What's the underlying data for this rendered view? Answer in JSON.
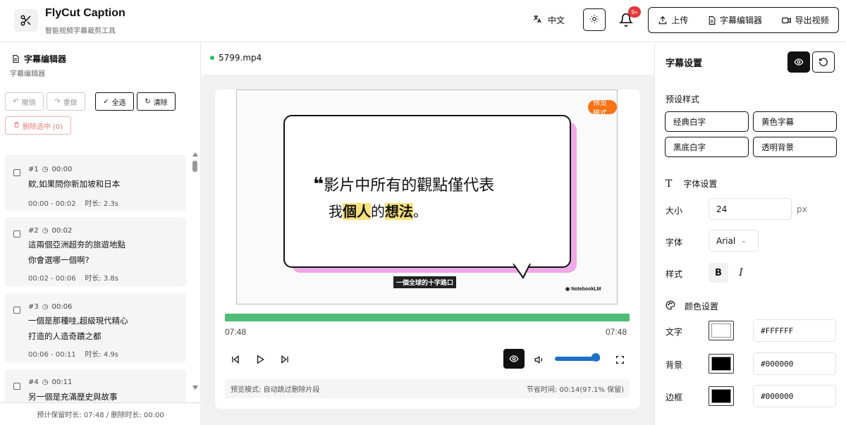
{
  "header": {
    "title": "FlyCut Caption",
    "subtitle": "智能视频字幕裁剪工具",
    "language": "中文",
    "notification_count": "9+",
    "upload_label": "上传",
    "editor_label": "字幕编辑器",
    "export_label": "导出视频"
  },
  "left_panel": {
    "title": "字幕编辑器",
    "subtitle": "字幕编辑器",
    "undo_label": "撤销",
    "redo_label": "重做",
    "select_all_label": "全选",
    "clear_label": "清除",
    "delete_selected_label": "删除选中 (0)",
    "items": [
      {
        "index": "#1",
        "time": "00:00",
        "lines": [
          "欸,如果問你新加坡和日本"
        ],
        "range": "00:00 - 00:02",
        "duration": "时长: 2.3s"
      },
      {
        "index": "#2",
        "time": "00:02",
        "lines": [
          "這兩個亞洲超夯的旅遊地點",
          "你會選哪一個啊?"
        ],
        "range": "00:02 - 00:06",
        "duration": "时长: 3.8s"
      },
      {
        "index": "#3",
        "time": "00:06",
        "lines": [
          "一個是那種哇,超級現代精心",
          "打造的人造奇蹟之都"
        ],
        "range": "00:06 - 00:11",
        "duration": "时长: 4.9s"
      },
      {
        "index": "#4",
        "time": "00:11",
        "lines": [
          "另一個是充滿歷史與故事"
        ],
        "range": "",
        "duration": ""
      }
    ],
    "footer": "预计保留时长: 07:48 / 删除时长: 00:00"
  },
  "player": {
    "filename": "5799.mp4",
    "preview_badge": "预览模式",
    "quote_line1": "影片中所有的觀點僅代表",
    "quote_line2_a": "我",
    "quote_line2_b": "個人",
    "quote_line2_c": "的",
    "quote_line2_d": "想法",
    "quote_line2_e": "。",
    "video_caption": "一個全球的十字路口",
    "watermark": "NotebookLM",
    "current_time": "07:48",
    "total_time": "07:48",
    "progress": 1.0,
    "volume": 0.9,
    "status_left": "预览模式: 自动跳过删除片段",
    "status_right": "节省时间: 00:14(97.1% 保留)"
  },
  "settings": {
    "title": "字幕设置",
    "presets_title": "预设样式",
    "presets": [
      "经典白字",
      "黄色字幕",
      "黑底白字",
      "透明背景"
    ],
    "font_section": "字体设置",
    "size_label": "大小",
    "size_value": "24",
    "size_unit": "px",
    "font_label": "字体",
    "font_value": "Arial",
    "style_label": "样式",
    "bold_label": "B",
    "italic_label": "I",
    "color_section": "颜色设置",
    "text_label": "文字",
    "text_color": "#FFFFFF",
    "bg_label": "背景",
    "bg_color": "#000000",
    "border_label": "边框",
    "border_color": "#000000"
  }
}
